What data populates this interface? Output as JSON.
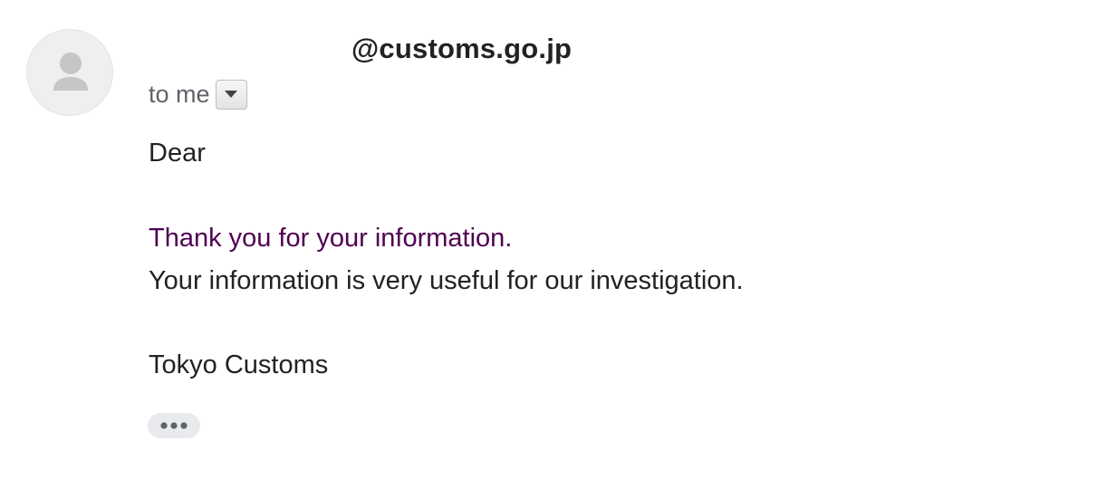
{
  "message": {
    "sender_address": "@customs.go.jp",
    "recipient_label": "to me",
    "details_icon": "caret-down-icon",
    "avatar_icon": "person-placeholder-icon",
    "body": {
      "greeting": "Dear",
      "thanks": "Thank you for your information.",
      "useful": "Your information is very useful for our investigation.",
      "signature": "Tokyo Customs"
    },
    "trimmed_content_icon": "ellipsis-icon"
  },
  "colors": {
    "quoted_text": "#500050",
    "secondary_text": "#5f6368",
    "primary_text": "#222222",
    "avatar_background": "#efefef",
    "avatar_glyph": "#c6c6c6",
    "trimmed_button_background": "#e8eaed"
  }
}
